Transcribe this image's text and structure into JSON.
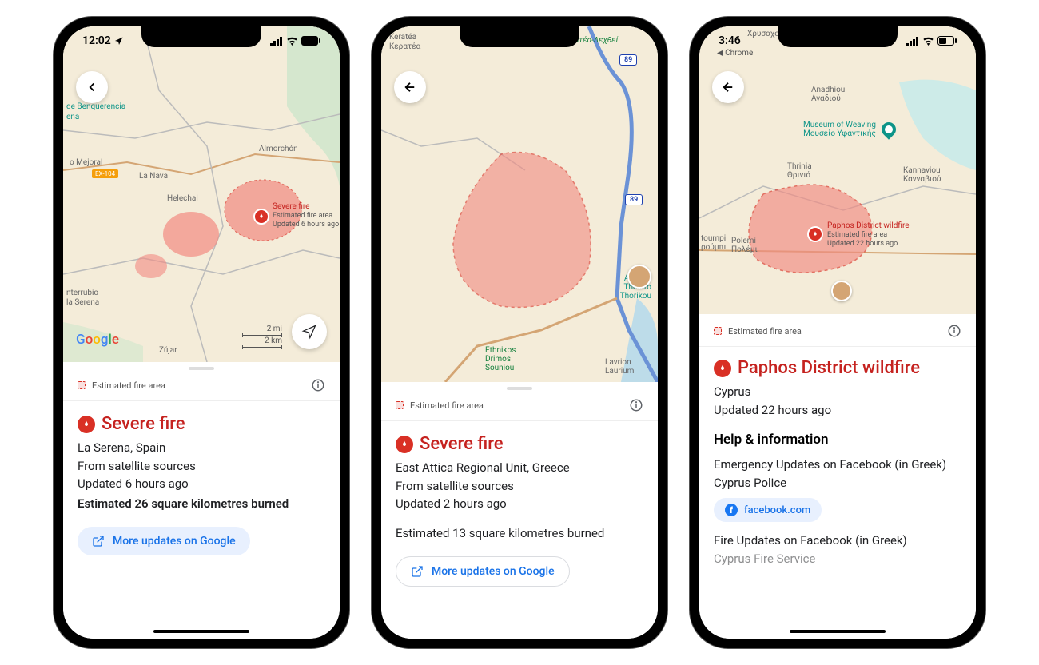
{
  "phones": [
    {
      "status_time": "12:02",
      "status_from": "",
      "map": {
        "places": [
          "de Benquerencia",
          "ena",
          "o Mejoral",
          "La Nava",
          "Helechal",
          "Almorchón",
          "nterrubio",
          "la Serena",
          "Zújar"
        ],
        "road_badge": "EX-104",
        "fire_label": {
          "title": "Severe fire",
          "sub1": "Estimated fire area",
          "sub2": "Updated 6 hours ago"
        },
        "scale": {
          "mi": "2 mi",
          "km": "2 km"
        },
        "logo": "Google"
      },
      "estimated_row_label": "Estimated fire area",
      "fire_title": "Severe fire",
      "location": "La Serena, Spain",
      "source": "From satellite sources",
      "updated": "Updated 6 hours ago",
      "estimate": "Estimated 26 square kilometres burned",
      "updates_button": "More updates on Google"
    },
    {
      "status_time": "",
      "map": {
        "places_top": [
          "Keratéa",
          "Κερατέα",
          "Κερατέα-Λεχθεί"
        ],
        "places_mid": [
          "Archaio Theatro",
          "Thorikou"
        ],
        "places_bottom": [
          "Ethnikos",
          "Drimos",
          "Souniou",
          "Lavrion",
          "Laurium"
        ],
        "road_shields": [
          "89",
          "89"
        ]
      },
      "estimated_row_label": "Estimated fire area",
      "fire_title": "Severe fire",
      "location": "East Attica Regional Unit, Greece",
      "source": "From satellite sources",
      "updated": "Updated 2 hours ago",
      "estimate": "Estimated 13 square kilometres burned",
      "updates_button": "More updates on Google"
    },
    {
      "status_time": "3:46",
      "status_from": "Chrome",
      "map": {
        "places_top": [
          "Χρυσοχούς"
        ],
        "places": [
          "Anadhiou",
          "Αναδιού",
          "Museum of Weaving",
          "Μουσείο Υφαντικής",
          "Thrinia",
          "Θρινιά",
          "Kannaviou",
          "Κανναβιού",
          "toumpi",
          "ρούμπι",
          "Polemi",
          "Πολέμι"
        ],
        "fire_label": {
          "title": "Paphos District wildfire",
          "sub1": "Estimated fire area",
          "sub2": "Updated 22 hours ago"
        }
      },
      "estimated_row_label": "Estimated fire area",
      "fire_title": "Paphos District wildfire",
      "location": "Cyprus",
      "updated": "Updated 22 hours ago",
      "help_title": "Help & information",
      "link1": "Emergency Updates on Facebook (in Greek)",
      "link1_source": "Cyprus Police",
      "fb_chip": "facebook.com",
      "link2": "Fire Updates on Facebook (in Greek)",
      "link2_source": "Cyprus Fire Service"
    }
  ]
}
